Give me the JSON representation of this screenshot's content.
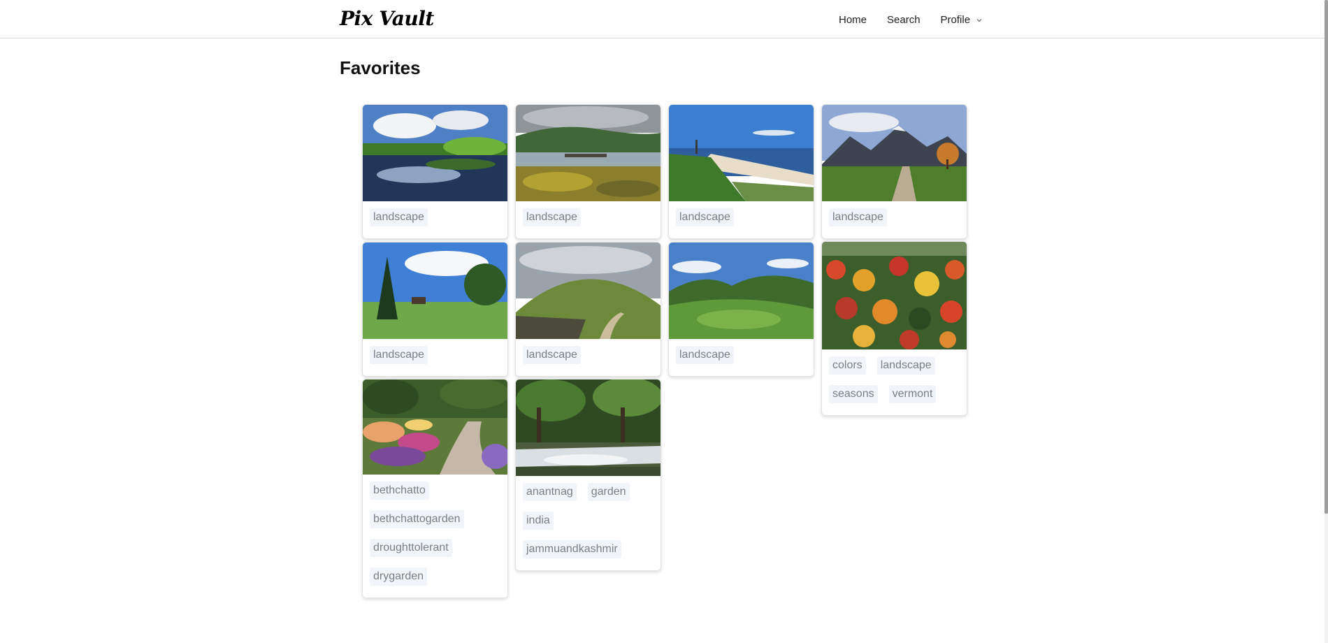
{
  "app": {
    "logo": "Pix Vault"
  },
  "nav": {
    "home": "Home",
    "search": "Search",
    "profile": "Profile"
  },
  "page": {
    "title": "Favorites"
  },
  "cards": [
    {
      "scene": "lake with clouds reflected, green trees",
      "tags": [
        "landscape"
      ]
    },
    {
      "scene": "jetty on a misty lake with green hills",
      "tags": [
        "landscape"
      ]
    },
    {
      "scene": "coastal beach with waves and blue sky",
      "tags": [
        "landscape"
      ]
    },
    {
      "scene": "mountain valley with path and autumn tree",
      "tags": [
        "landscape"
      ]
    },
    {
      "scene": "meadow with tall trees and cabin",
      "tags": [
        "landscape"
      ]
    },
    {
      "scene": "grassy hill with winding path",
      "tags": [
        "landscape"
      ]
    },
    {
      "scene": "green rolling valley with mountains",
      "tags": [
        "landscape"
      ]
    },
    {
      "scene": "aerial autumn forest in colors",
      "tags": [
        "colors",
        "landscape",
        "seasons",
        "vermont"
      ]
    },
    {
      "scene": "flower garden with gravel path",
      "tags": [
        "bethchatto",
        "bethchattogarden",
        "droughttolerant",
        "drygarden"
      ]
    },
    {
      "scene": "stream cascading through forest",
      "tags": [
        "anantnag",
        "garden",
        "india",
        "jammuandkashmir"
      ]
    }
  ]
}
